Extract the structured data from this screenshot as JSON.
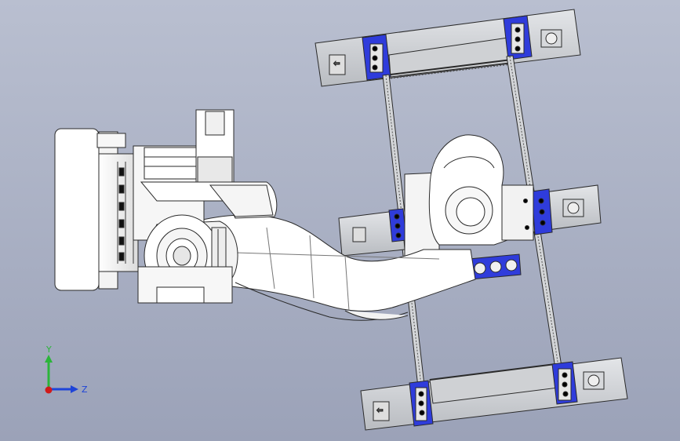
{
  "viewport": {
    "background_top": "#b9bfd0",
    "background_bottom": "#9ba2b8"
  },
  "model": {
    "part_fill": "#ffffff",
    "part_stroke": "#2a2a2a",
    "rail_fill": "#d3d5d8",
    "rail_dark": "#8d9096",
    "bracket_fill": "#2f3cdb",
    "hole_fill": "#0a0a0a"
  },
  "triad": {
    "y_label": "Y",
    "z_label": "Z",
    "y_color": "#2bb53a",
    "z_color": "#1e44d8",
    "x_color": "#d11a1a"
  }
}
